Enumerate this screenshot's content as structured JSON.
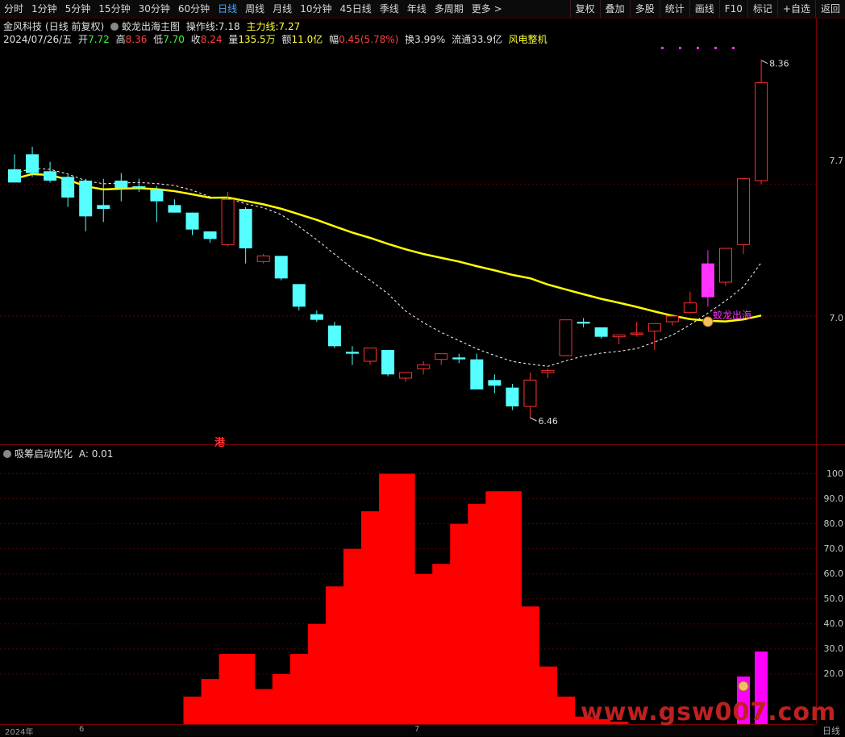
{
  "toolbar": {
    "periods": [
      "分时",
      "1分钟",
      "5分钟",
      "15分钟",
      "30分钟",
      "60分钟",
      "日线",
      "周线",
      "月线",
      "10分钟",
      "45日线",
      "季线",
      "年线",
      "多周期",
      "更多 >"
    ],
    "active": "日线",
    "right_buttons": [
      "复权",
      "叠加",
      "多股",
      "统计",
      "画线",
      "F10",
      "标记",
      "+自选",
      "返回"
    ]
  },
  "header": {
    "stock_name": "金风科技",
    "mode": "(日线 前复权)",
    "indicator_name": "蛟龙出海主图",
    "op_line_label": "操作线:",
    "op_line_value": "7.18",
    "main_line_label": "主力线:",
    "main_line_value": "7.27"
  },
  "quote": {
    "date": "2024/07/26/五",
    "open_label": "开",
    "open": "7.72",
    "high_label": "高",
    "high": "8.36",
    "low_label": "低",
    "low": "7.70",
    "close_label": "收",
    "close": "8.24",
    "volume_label": "量",
    "volume": "135.5万",
    "amount_label": "额",
    "amount": "11.0亿",
    "change_label": "幅",
    "change": "0.45(5.78%)",
    "turnover_label": "换",
    "turnover": "3.99%",
    "float_label": "流通",
    "float": "33.9亿",
    "concept": "风电整机"
  },
  "price_axis": [
    "7.7",
    "7.0"
  ],
  "annotations": {
    "high_mark": "8.36",
    "low_mark": "6.46",
    "signal": "蛟龙出海",
    "gang": "港"
  },
  "sub_panel": {
    "title": "吸筹启动优化",
    "a_label": "A:",
    "a_value": "0.01",
    "axis": [
      "100",
      "90.0",
      "80.0",
      "70.0",
      "60.0",
      "50.0",
      "40.0",
      "30.0",
      "20.0"
    ]
  },
  "date_axis": [
    "2024年",
    "6",
    "7"
  ],
  "bottom_tab": "日线",
  "watermark": "www.gsw007.com",
  "colors": {
    "up": "#ff3030",
    "down": "#55ffff",
    "signal": "#ff33ff",
    "main_line": "#ffff00",
    "bar": "#ff0000",
    "bar_signal": "#ff00ff"
  },
  "chart_data": [
    {
      "type": "candlestick",
      "title": "蛟龙出海主图",
      "series": [
        {
          "name": "K",
          "values": [
            [
              7.78,
              7.86,
              7.71,
              7.71
            ],
            [
              7.86,
              7.9,
              7.76,
              7.74
            ],
            [
              7.77,
              7.82,
              7.72,
              7.71
            ],
            [
              7.74,
              7.75,
              7.63,
              7.58
            ],
            [
              7.72,
              7.73,
              7.53,
              7.45
            ],
            [
              7.59,
              7.73,
              7.57,
              7.5
            ],
            [
              7.72,
              7.76,
              7.68,
              7.61
            ],
            [
              7.69,
              7.73,
              7.68,
              7.66
            ],
            [
              7.67,
              7.69,
              7.61,
              7.5
            ],
            [
              7.59,
              7.62,
              7.55,
              7.55
            ],
            [
              7.55,
              7.55,
              7.46,
              7.43
            ],
            [
              7.45,
              7.45,
              7.41,
              7.39
            ],
            [
              7.38,
              7.66,
              7.62,
              7.37
            ],
            [
              7.57,
              7.58,
              7.36,
              7.28
            ],
            [
              7.29,
              7.33,
              7.32,
              7.28
            ],
            [
              7.32,
              7.32,
              7.2,
              7.19
            ],
            [
              7.17,
              7.17,
              7.05,
              7.03
            ],
            [
              7.01,
              7.03,
              6.98,
              6.97
            ],
            [
              6.95,
              6.97,
              6.84,
              6.83
            ],
            [
              6.81,
              6.84,
              6.8,
              6.74
            ],
            [
              6.76,
              6.8,
              6.83,
              6.74
            ],
            [
              6.82,
              6.82,
              6.69,
              6.68
            ],
            [
              6.67,
              6.7,
              6.7,
              6.65
            ],
            [
              6.72,
              6.76,
              6.74,
              6.69
            ],
            [
              6.77,
              6.8,
              6.8,
              6.74
            ],
            [
              6.78,
              6.8,
              6.77,
              6.75
            ],
            [
              6.77,
              6.8,
              6.61,
              6.61
            ],
            [
              6.66,
              6.69,
              6.63,
              6.59
            ],
            [
              6.62,
              6.64,
              6.52,
              6.5
            ],
            [
              6.52,
              6.7,
              6.66,
              6.46
            ],
            [
              6.7,
              6.72,
              6.71,
              6.67
            ],
            [
              6.79,
              6.98,
              6.98,
              6.79
            ],
            [
              6.97,
              6.99,
              6.96,
              6.94
            ],
            [
              6.94,
              6.94,
              6.89,
              6.88
            ],
            [
              6.89,
              6.9,
              6.9,
              6.85
            ],
            [
              6.91,
              6.97,
              6.91,
              6.89
            ],
            [
              6.92,
              6.96,
              6.96,
              6.82
            ],
            [
              6.97,
              7.0,
              7.0,
              6.95
            ],
            [
              7.02,
              7.13,
              7.07,
              7.02
            ],
            [
              7.1,
              7.35,
              7.28,
              7.05
            ],
            [
              7.18,
              7.35,
              7.36,
              7.16
            ],
            [
              7.38,
              7.6,
              7.73,
              7.33
            ],
            [
              7.72,
              8.36,
              8.24,
              7.7
            ]
          ]
        }
      ],
      "ylim": [
        6.4,
        8.5
      ]
    },
    {
      "type": "bar",
      "title": "吸筹启动优化",
      "values": [
        0,
        0,
        0,
        0,
        0,
        0,
        0,
        0,
        0,
        0,
        11,
        18,
        28,
        28,
        14,
        20,
        28,
        40,
        55,
        70,
        85,
        100,
        100,
        60,
        64,
        80,
        88,
        93,
        93,
        47,
        23,
        11,
        3,
        2,
        1,
        0,
        0,
        0,
        0,
        0,
        0,
        19,
        29
      ],
      "signal_index": [
        41,
        42
      ],
      "ylim": [
        0,
        105
      ]
    }
  ]
}
